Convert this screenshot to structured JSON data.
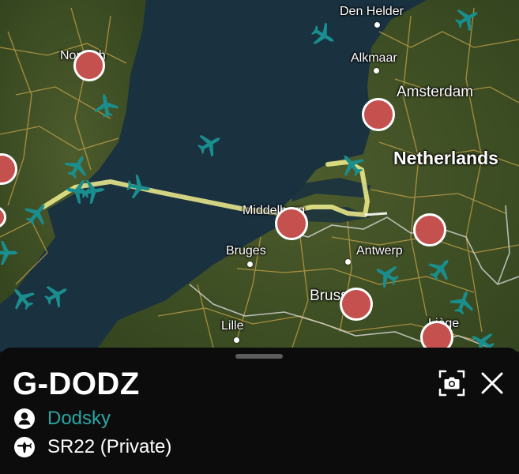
{
  "map": {
    "cities": [
      {
        "id": "den-helder",
        "label": "Den Helder"
      },
      {
        "id": "alkmaar",
        "label": "Alkmaar"
      },
      {
        "id": "amsterdam",
        "label": "Amsterdam"
      },
      {
        "id": "netherlands",
        "label": "Netherlands"
      },
      {
        "id": "norwich",
        "label": "Norwich"
      },
      {
        "id": "middelburg",
        "label": "Middelburg"
      },
      {
        "id": "bruges",
        "label": "Bruges"
      },
      {
        "id": "antwerp",
        "label": "Antwerp"
      },
      {
        "id": "brussels",
        "label": "Brussels"
      },
      {
        "id": "lille",
        "label": "Lille"
      },
      {
        "id": "liege",
        "label": "Liège"
      }
    ],
    "airport_marker_color": "#c4514e",
    "aircraft_icon_color": "#1a8e8e",
    "flight_track_color": "#f2f08e"
  },
  "aircraft": {
    "registration": "G-DODZ",
    "owner": "Dodsky",
    "type": "SR22 (Private)",
    "owner_icon": "person-icon",
    "type_icon": "airplane-icon"
  },
  "actions": {
    "camera_icon": "camera-icon",
    "close_icon": "close-icon"
  }
}
